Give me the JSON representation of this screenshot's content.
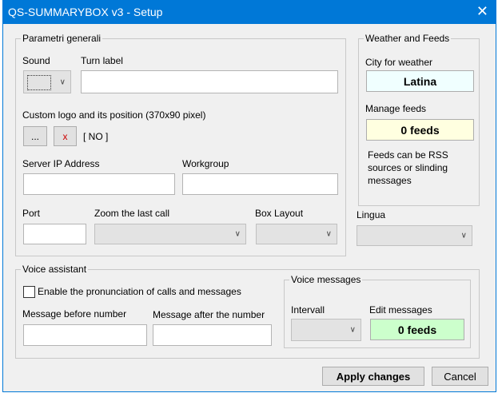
{
  "window": {
    "title": "QS-SUMMARYBOX v3 - Setup",
    "close": "✕"
  },
  "general": {
    "legend": "Parametri generali",
    "sound_label": "Sound",
    "turn_label": "Turn label",
    "logo_label": "Custom logo and its position (370x90 pixel)",
    "browse": "...",
    "remove": "x",
    "logo_status": "[ NO ]",
    "server_label": "Server IP Address",
    "workgroup_label": "Workgroup",
    "port_label": "Port",
    "zoom_label": "Zoom the last call",
    "layout_label": "Box Layout"
  },
  "weather": {
    "legend": "Weather and Feeds",
    "city_label": "City for weather",
    "city": "Latina",
    "feeds_label": "Manage feeds",
    "feeds": "0 feeds",
    "note": "Feeds can be RSS sources or slinding messages",
    "city_bg": "#f0ffff",
    "feeds_bg": "#ffffe0"
  },
  "lingua": {
    "label": "Lingua"
  },
  "voice": {
    "legend": "Voice assistant",
    "enable": "Enable the pronunciation of calls and messages",
    "before_label": "Message before number",
    "after_label": "Message after the number",
    "messages_legend": "Voice messages",
    "interval_label": "Intervall",
    "edit_label": "Edit messages",
    "edit_value": "0 feeds",
    "edit_bg": "#ccffcc"
  },
  "buttons": {
    "apply": "Apply changes",
    "cancel": "Cancel"
  }
}
